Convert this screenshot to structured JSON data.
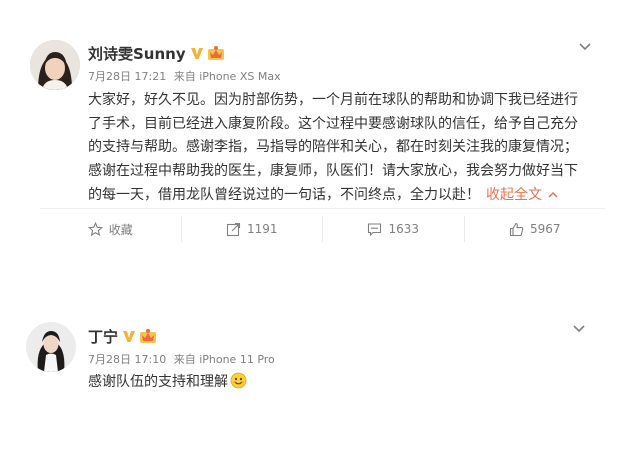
{
  "posts": [
    {
      "username": "刘诗雯Sunny",
      "meta": {
        "date": "7月28日 17:21",
        "source": "来自 iPhone XS Max"
      },
      "lines": [
        "大家好，好久不见。因为肘部伤势，一个月前在球队的帮助和协调下我已经进行",
        "了手术，目前已经进入康复阶段。这个过程中要感谢球队的信任，给予自己充分",
        "的支持与帮助。感谢李指，马指导的陪伴和关心，都在时刻关注我的康复情况；",
        "感谢在过程中帮助我的医生，康复师，队医们！请大家放心，我会努力做好当下",
        "的每一天，借用龙队曾经说过的一句话，不问终点，全力以赴！"
      ],
      "expand_label": "收起全文",
      "actions": {
        "favorite": "收藏",
        "repost": "1191",
        "comment": "1633",
        "like": "5967"
      }
    },
    {
      "username": "丁宁",
      "meta": {
        "date": "7月28日 17:10",
        "source": "来自 iPhone 11 Pro"
      },
      "text": "感谢队伍的支持和理解"
    }
  ],
  "icons": {
    "verified": "verified-v-icon",
    "member": "member-crown-icon",
    "more": "chevron-down-icon",
    "emoji": "smile-emoji-icon"
  },
  "colors": {
    "accent_link": "#eb7350",
    "verified_gold": "#f3b23a",
    "meta_gray": "#808080"
  }
}
